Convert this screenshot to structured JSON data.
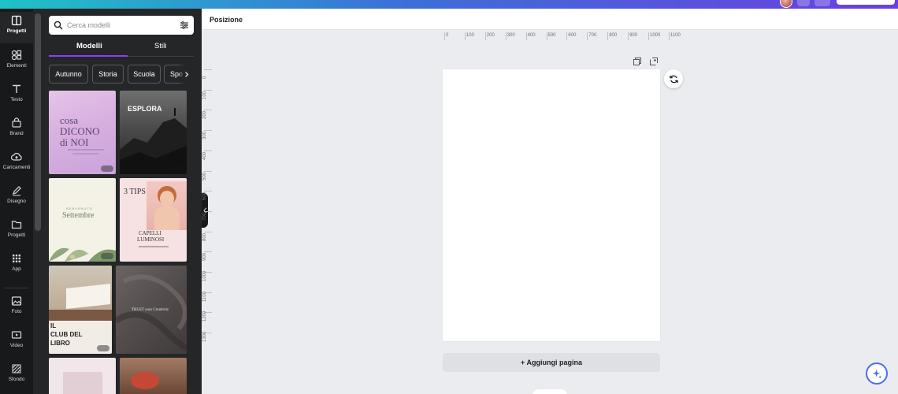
{
  "sidebar": {
    "items": [
      {
        "label": "Progetti",
        "icon": "layout-icon",
        "active": true
      },
      {
        "label": "Elementi",
        "icon": "shapes-icon"
      },
      {
        "label": "Testo",
        "icon": "text-icon"
      },
      {
        "label": "Brand",
        "icon": "brand-icon"
      },
      {
        "label": "Caricamenti",
        "icon": "cloud-upload-icon"
      },
      {
        "label": "Disegno",
        "icon": "pen-icon"
      },
      {
        "label": "Progetti",
        "icon": "folder-icon"
      },
      {
        "label": "App",
        "icon": "apps-grid-icon"
      },
      {
        "label": "Foto",
        "icon": "image-icon"
      },
      {
        "label": "Video",
        "icon": "video-icon"
      },
      {
        "label": "Sfondo",
        "icon": "background-pattern-icon"
      }
    ]
  },
  "panel": {
    "search": {
      "placeholder": "Cerca modelli",
      "value": ""
    },
    "tabs": [
      {
        "label": "Modelli",
        "active": true
      },
      {
        "label": "Stili"
      }
    ],
    "chips": [
      "Autunno",
      "Storia",
      "Scuola",
      "Spo"
    ],
    "templates": {
      "t1": {
        "line1": "cosa",
        "line2": "DICONO",
        "line3": "di NOI"
      },
      "t2": {
        "line1": "ESPLORA"
      },
      "t3": {
        "line1": "BENVENUTO",
        "line2": "Settembre"
      },
      "t4": {
        "line1": "3 TIPS",
        "line2": "CAPELLI",
        "line3": "LUMINOSI"
      },
      "t5": {
        "line1": "IL",
        "line2": "CLUB DEL",
        "line3": "LIBRO"
      },
      "t6": {
        "line1": "TRUST your Creativity"
      }
    }
  },
  "editor": {
    "position_label": "Posizione",
    "ruler_h": [
      "0",
      "100",
      "200",
      "300",
      "400",
      "500",
      "600",
      "700",
      "800",
      "900",
      "1000",
      "1100"
    ],
    "ruler_v": [
      "0",
      "100",
      "200",
      "300",
      "400",
      "500",
      "600",
      "700",
      "800",
      "900",
      "1000",
      "1100",
      "1200",
      "1300"
    ],
    "add_page_label": "+ Aggiungi pagina"
  },
  "colors": {
    "accent": "#8b3dff",
    "rail_bg": "#18191b",
    "panel_bg": "#252627",
    "canvas_bg": "#ebecf0"
  }
}
